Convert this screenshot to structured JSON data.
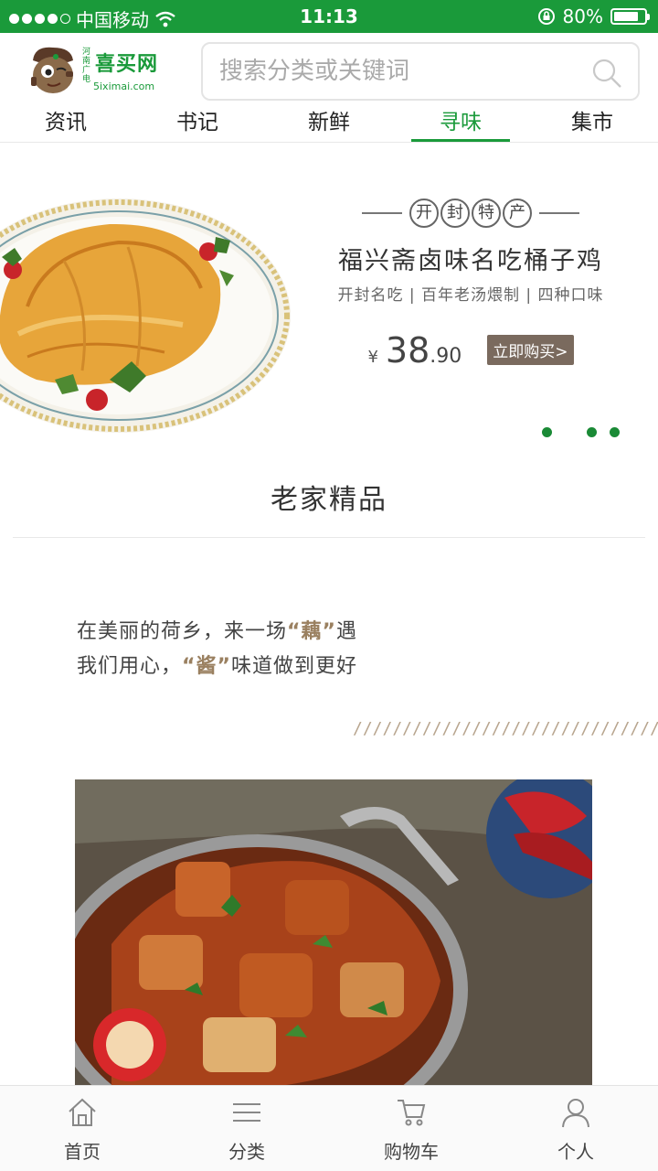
{
  "status_bar": {
    "carrier": "中国移动",
    "time": "11:13",
    "battery": "80%",
    "battery_level": 0.8
  },
  "header": {
    "logo_name": "喜买网",
    "logo_side": "河南广电",
    "logo_domain": "5iximai.com",
    "search_placeholder": "搜索分类或关键词"
  },
  "tabs": [
    {
      "label": "资讯",
      "active": false
    },
    {
      "label": "书记",
      "active": false
    },
    {
      "label": "新鲜",
      "active": false
    },
    {
      "label": "寻味",
      "active": true
    },
    {
      "label": "集市",
      "active": false
    }
  ],
  "banner": {
    "tag_chars": [
      "开",
      "封",
      "特",
      "产"
    ],
    "title": "福兴斋卤味名吃桶子鸡",
    "subtitle": "开封名吃 | 百年老汤煨制 | 四种口味",
    "currency": "¥",
    "price_int": "38",
    "price_dec": ".90",
    "buy_label": "立即购买>"
  },
  "section": {
    "title": "老家精品",
    "line1_a": "在美丽的荷乡，来一场",
    "line1_hl": "“藕”",
    "line1_b": "遇",
    "line2_a": "我们用心，",
    "line2_hl": "“酱”",
    "line2_b": "味道做到更好",
    "slashes": "////////////////////////////////"
  },
  "bottom_nav": [
    {
      "label": "首页",
      "icon": "home-icon"
    },
    {
      "label": "分类",
      "icon": "menu-icon"
    },
    {
      "label": "购物车",
      "icon": "cart-icon"
    },
    {
      "label": "个人",
      "icon": "user-icon"
    }
  ],
  "colors": {
    "brand_green": "#1a9a3a",
    "buy_button": "#7a6a5e",
    "highlight": "#9a8060"
  }
}
